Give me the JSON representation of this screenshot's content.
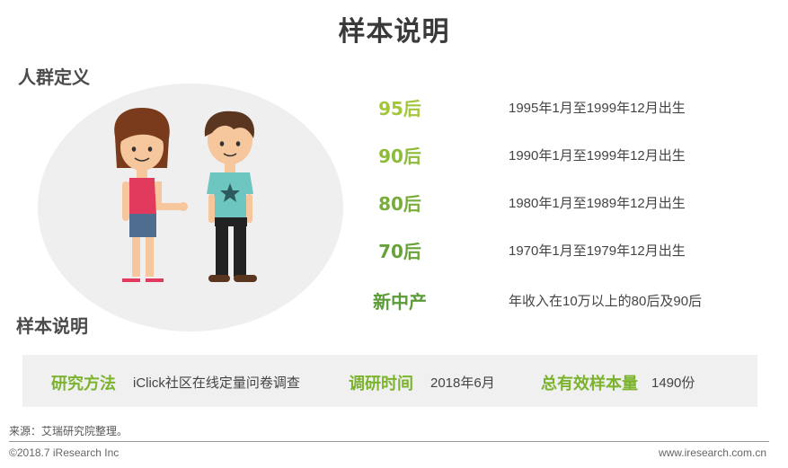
{
  "title": "样本说明",
  "section_people": "人群定义",
  "section_sample": "样本说明",
  "colors": {
    "accent_light": "#8dc63f",
    "accent_dark": "#62a83a",
    "bar_bg": "#f0f0f0"
  },
  "groups": [
    {
      "label": "95后",
      "desc": "1995年1月至1999年12月出生",
      "color": "#a2c73b"
    },
    {
      "label": "90后",
      "desc": "1990年1月至1999年12月出生",
      "color": "#8dbb3a"
    },
    {
      "label": "80后",
      "desc": "1980年1月至1989年12月出生",
      "color": "#78ad3b"
    },
    {
      "label": "70后",
      "desc": "1970年1月至1979年12月出生",
      "color": "#67a33a"
    },
    {
      "label": "新中产",
      "desc": "年收入在10万以上的80后及90后",
      "color": "#5b9b38"
    }
  ],
  "method": {
    "method_label": "研究方法",
    "method_value": "iClick社区在线定量问卷调查",
    "time_label": "调研时间",
    "time_value": "2018年6月",
    "sample_label": "总有效样本量",
    "sample_value": "1490份"
  },
  "footer": {
    "source": "来源：艾瑞研究院整理。",
    "copyright": "©2018.7 iResearch  Inc",
    "site": "www.iresearch.com.cn"
  }
}
